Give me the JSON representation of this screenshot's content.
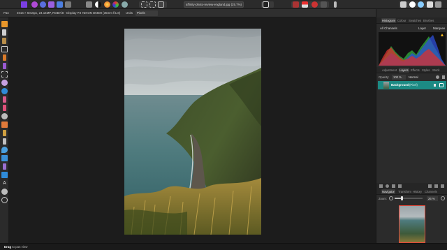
{
  "toolbar": {
    "document_title": "affinity-photo-review-england.jpg (25.7%)"
  },
  "context_bar": {
    "tool_name": "Pan",
    "image_info": "4016 × 6016px, 24.16MP, RGBA/8 · Display P3",
    "camera_info": "NIKON D5500 (35mm f/1.8)",
    "units_label": "Units",
    "units_value": "Pixels"
  },
  "studio_top": {
    "tabs": [
      "Histogram",
      "Colour",
      "Swatches",
      "Brushes"
    ],
    "active_tab": "Histogram",
    "channels_value": "All Channels",
    "layer_option": "Layer",
    "marquee_option": "Marquee",
    "warning_icon": "warning-triangle-icon"
  },
  "layers_panel": {
    "tabs": [
      "Adjustment",
      "Layers",
      "Effects",
      "Styles",
      "Stock"
    ],
    "active_tab": "Layers",
    "opacity_label": "Opacity:",
    "opacity_value": "100 %",
    "blend_mode": "Normal",
    "layers": [
      {
        "name": "Background",
        "detail": "(Pixel)",
        "selected": true,
        "visible": true,
        "locked": true
      }
    ]
  },
  "navigator_panel": {
    "tabs": [
      "Navigator",
      "Transform",
      "History",
      "Channels"
    ],
    "active_tab": "Navigator",
    "zoom_label": "Zoom:",
    "zoom_value": "26 %",
    "zoom_fraction": 0.26
  },
  "status_bar": {
    "action": "Drag",
    "hint": "to pan view"
  },
  "colors": {
    "accent_teal": "#1c8a84",
    "app_logo": "#7b3fe4",
    "panel_bg": "#2b2b2b",
    "canvas_bg": "#1c1c1c"
  }
}
